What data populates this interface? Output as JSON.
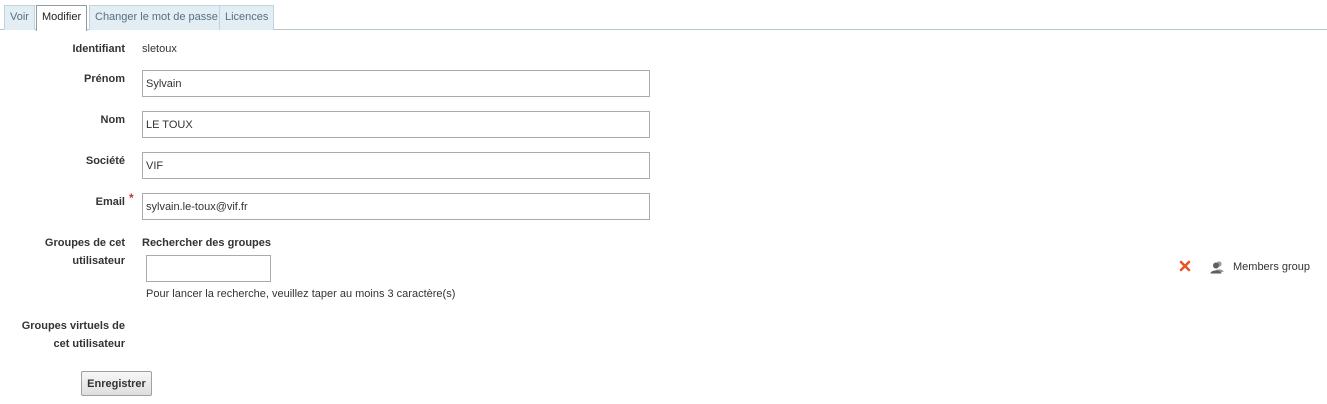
{
  "tabs": [
    {
      "label": "Voir"
    },
    {
      "label": "Modifier",
      "active": true
    },
    {
      "label": "Changer le mot de passe"
    },
    {
      "label": "Licences"
    }
  ],
  "form": {
    "identifiant": {
      "label": "Identifiant",
      "value": "sletoux"
    },
    "prenom": {
      "label": "Prénom",
      "value": "Sylvain"
    },
    "nom": {
      "label": "Nom",
      "value": "LE TOUX"
    },
    "societe": {
      "label": "Société",
      "value": "VIF"
    },
    "email": {
      "label": "Email",
      "value": "sylvain.le-toux@vif.fr",
      "required_mark": "*"
    },
    "groups": {
      "label_line1": "Groupes de cet",
      "label_line2": "utilisateur",
      "search_title": "Rechercher des groupes",
      "search_value": "",
      "hint": "Pour lancer la recherche, veuillez taper au moins 3 caractère(s)",
      "selected": [
        {
          "name": "Members group",
          "icon": "group-icon",
          "remove_icon": "remove-x-icon"
        }
      ]
    },
    "virtual_groups": {
      "label_line1": "Groupes virtuels de",
      "label_line2": "cet utilisateur"
    },
    "save_label": "Enregistrer"
  },
  "colors": {
    "tab_background": "#e3edf4",
    "tab_border": "#c3d3de",
    "remove_icon": "#e8542b",
    "required": "#c0392b"
  }
}
